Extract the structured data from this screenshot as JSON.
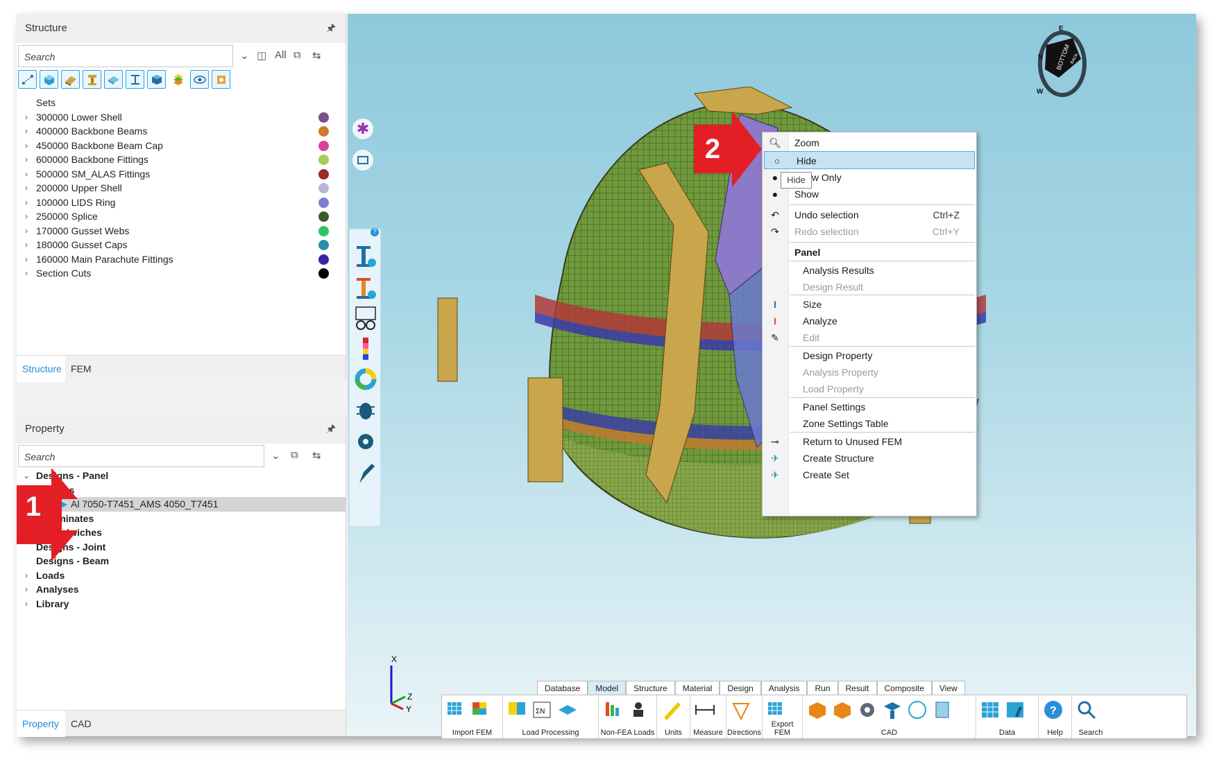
{
  "structure_panel": {
    "title": "Structure",
    "search_placeholder": "Search",
    "filter_all": "All",
    "tree": [
      {
        "label": "Sets",
        "expandable": false
      },
      {
        "label": "300000 Lower Shell",
        "color": "#7a4f8a"
      },
      {
        "label": "400000 Backbone Beams",
        "color": "#cf7a2e"
      },
      {
        "label": "450000 Backbone Beam Cap",
        "color": "#d9429a"
      },
      {
        "label": "600000 Backbone Fittings",
        "color": "#a7cc57"
      },
      {
        "label": "500000 SM_ALAS Fittings",
        "color": "#9a2a2a"
      },
      {
        "label": "200000 Upper Shell",
        "color": "#b9b6d6"
      },
      {
        "label": "100000 LIDS Ring",
        "color": "#7f7fd0"
      },
      {
        "label": "250000 Splice",
        "color": "#3d5a2a"
      },
      {
        "label": "170000 Gusset Webs",
        "color": "#2fc463"
      },
      {
        "label": "180000 Gusset Caps",
        "color": "#2b8fa8"
      },
      {
        "label": "160000 Main Parachute Fittings",
        "color": "#3a25a8"
      },
      {
        "label": "Section Cuts",
        "color": "#000000"
      }
    ],
    "tabs": [
      "Structure",
      "FEM"
    ]
  },
  "property_panel": {
    "title": "Property",
    "search_placeholder": "Search",
    "tree": {
      "designs_panel": "Designs - Panel",
      "plates": "Plates",
      "material": "Al 7050-T7451_AMS 4050_T7451",
      "laminates": "Laminates",
      "sandwiches": "Sandwiches",
      "designs_joint": "Designs - Joint",
      "designs_beam": "Designs - Beam",
      "loads": "Loads",
      "analyses": "Analyses",
      "library": "Library"
    },
    "tabs": [
      "Property",
      "CAD"
    ]
  },
  "context_menu": {
    "zoom": "Zoom",
    "hide": "Hide",
    "show_only": "Show Only",
    "show": "Show",
    "undo": "Undo selection",
    "undo_sc": "Ctrl+Z",
    "redo": "Redo selection",
    "redo_sc": "Ctrl+Y",
    "panel_header": "Panel",
    "analysis_results": "Analysis Results",
    "design_result": "Design Result",
    "size": "Size",
    "analyze": "Analyze",
    "edit": "Edit",
    "design_property": "Design Property",
    "analysis_property": "Analysis Property",
    "load_property": "Load Property",
    "panel_settings": "Panel Settings",
    "zone_settings": "Zone Settings Table",
    "return_unused": "Return to Unused FEM",
    "create_structure": "Create Structure",
    "create_set": "Create Set"
  },
  "tooltip": "Hide",
  "annotations": {
    "step1": "1",
    "step2": "2"
  },
  "view_cube": {
    "face_label": "BOTTOM",
    "side_label": "BACK",
    "compass": [
      "E",
      "W",
      "N"
    ]
  },
  "axes": {
    "x": "X",
    "y": "Y",
    "z": "Z"
  },
  "ribbon": {
    "tabs": [
      "Database",
      "Model",
      "Structure",
      "Material",
      "Design",
      "Analysis",
      "Run",
      "Result",
      "Composite",
      "View"
    ],
    "active_tab": "Model",
    "groups": [
      "Import FEM",
      "Load Processing",
      "Non-FEA Loads",
      "Units",
      "Measure",
      "Directions",
      "Export FEM",
      "CAD",
      "Data",
      "Help",
      "Search"
    ]
  },
  "colors": {
    "accent": "#1f8dd6",
    "annotation_red": "#e31e25",
    "mesh_green": "#6f9a3c"
  }
}
